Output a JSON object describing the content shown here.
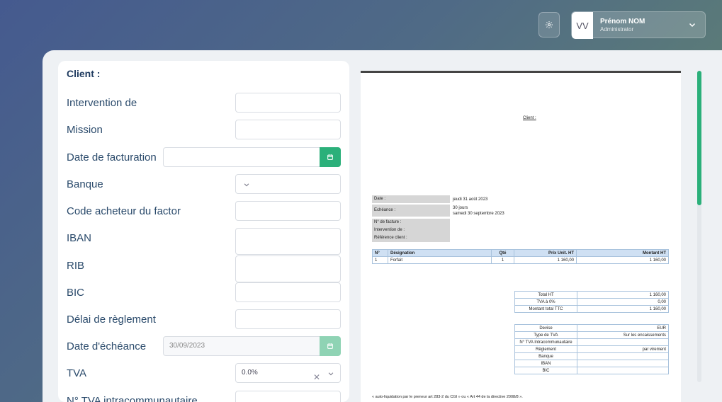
{
  "header": {
    "user_initials": "VV",
    "user_name": "Prénom NOM",
    "user_role": "Administrator"
  },
  "form": {
    "title": "Client :",
    "intervention_label": "Intervention de",
    "mission_label": "Mission",
    "date_facturation_label": "Date de facturation",
    "banque_label": "Banque",
    "code_acheteur_label": "Code acheteur du factor",
    "iban_label": "IBAN",
    "rib_label": "RIB",
    "bic_label": "BIC",
    "delai_label": "Délai de règlement",
    "date_echeance_label": "Date d'échéance",
    "date_echeance_value": "30/09/2023",
    "tva_label": "TVA",
    "tva_value": "0.0%",
    "tva_intra_label": "N° TVA intracommunautaire"
  },
  "doc": {
    "client_label": "Client :",
    "info": {
      "date_k": "Date :",
      "date_v": "jeudi 31 août 2023",
      "echeance_k": "Echéance :",
      "echeance_v1": "30 jours",
      "echeance_v2": "samedi 30 septembre 2023",
      "facture_k": "N° de facture :",
      "intervention_k": "Intervention de :",
      "reference_k": "Référence client :"
    },
    "items": {
      "h_no": "N°",
      "h_designation": "Désignation",
      "h_qte": "Qté",
      "h_pu": "Prix Unit. HT",
      "h_montant": "Montant HT",
      "r_no": "1",
      "r_designation": "Forfait",
      "r_qte": "1",
      "r_pu": "1 160,00",
      "r_montant": "1 160,00"
    },
    "totals": {
      "ht_k": "Total HT",
      "ht_v": "1 160,00",
      "tva_k": "TVA à 0%",
      "tva_v": "0,00",
      "ttc_k": "Montant total TTC",
      "ttc_v": "1 160,00"
    },
    "pay": {
      "devise_k": "Devise",
      "devise_v": "EUR",
      "type_tva_k": "Type de TVA",
      "type_tva_v": "Sur les encaissements",
      "tva_intra_k": "N° TVA Intracommunautaire",
      "reglement_k": "Règlement",
      "reglement_v": "par virement",
      "banque_k": "Banque",
      "iban_k": "IBAN",
      "bic_k": "BIC"
    },
    "footer": "« auto-liquidation par le preneur art 283-2 du CGI » ou « Art 44 de la directive 2008/8 »."
  },
  "colors": {
    "accent": "#2bb07a",
    "title": "#1e3a5f",
    "label": "#2a4a6b"
  },
  "icons": {
    "settings": "gear-icon",
    "dropdown": "chevron-down-icon",
    "calendar": "calendar-icon",
    "clear": "close-icon"
  }
}
